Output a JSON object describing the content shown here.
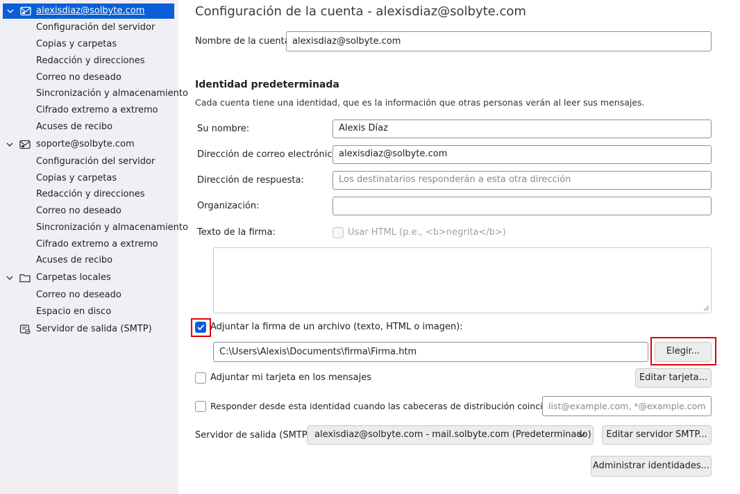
{
  "sidebar": {
    "accounts": [
      {
        "label": "alexisdiaz@solbyte.com",
        "icon": "mail-account-icon",
        "selected": true,
        "items": [
          "Configuración del servidor",
          "Copias y carpetas",
          "Redacción y direcciones",
          "Correo no deseado",
          "Sincronización y almacenamiento",
          "Cifrado extremo a extremo",
          "Acuses de recibo"
        ]
      },
      {
        "label": "soporte@solbyte.com",
        "icon": "mail-account-icon",
        "selected": false,
        "items": [
          "Configuración del servidor",
          "Copias y carpetas",
          "Redacción y direcciones",
          "Correo no deseado",
          "Sincronización y almacenamiento",
          "Cifrado extremo a extremo",
          "Acuses de recibo"
        ]
      },
      {
        "label": "Carpetas locales",
        "icon": "folder-icon",
        "selected": false,
        "items": [
          "Correo no deseado",
          "Espacio en disco"
        ]
      }
    ],
    "smtp": {
      "label": "Servidor de salida (SMTP)",
      "icon": "outgoing-server-icon"
    }
  },
  "main": {
    "title": "Configuración de la cuenta - alexisdiaz@solbyte.com",
    "account_name": {
      "label": "Nombre de la cuenta:",
      "value": "alexisdiaz@solbyte.com"
    },
    "identity": {
      "heading": "Identidad predeterminada",
      "description": "Cada cuenta tiene una identidad, que es la información que otras personas verán al leer sus mensajes.",
      "name": {
        "label": "Su nombre:",
        "value": "Alexis Díaz"
      },
      "email": {
        "label": "Dirección de correo electrónico:",
        "value": "alexisdiaz@solbyte.com"
      },
      "reply_to": {
        "label": "Dirección de respuesta:",
        "placeholder": "Los destinatarios responderán a esta otra dirección"
      },
      "organization": {
        "label": "Organización:",
        "value": ""
      },
      "signature": {
        "label": "Texto de la firma:",
        "use_html_label": "Usar HTML (p.e., <b>negrita</b>)",
        "use_html_checked": false,
        "use_html_disabled": true,
        "text": ""
      }
    },
    "attach_signature": {
      "label": "Adjuntar la firma de un archivo (texto, HTML o imagen):",
      "checked": true,
      "path": "C:\\Users\\Alexis\\Documents\\firma\\Firma.htm",
      "choose_button": "Elegir..."
    },
    "vcard": {
      "label": "Adjuntar mi tarjeta en los mensajes",
      "checked": false,
      "edit_button": "Editar tarjeta..."
    },
    "reply_from": {
      "label": "Responder desde esta identidad cuando las cabeceras de distribución coinciden:",
      "checked": false,
      "placeholder": "list@example.com, *@example.com"
    },
    "smtp": {
      "label": "Servidor de salida (SMTP):",
      "selected": "alexisdiaz@solbyte.com - mail.solbyte.com (Predeterminado)",
      "edit_button": "Editar servidor SMTP..."
    },
    "manage_identities_button": "Administrar identidades..."
  },
  "colors": {
    "accent": "#0a5fd8",
    "sidebar_bg": "#f0f0f4",
    "highlight": "#e00000"
  }
}
